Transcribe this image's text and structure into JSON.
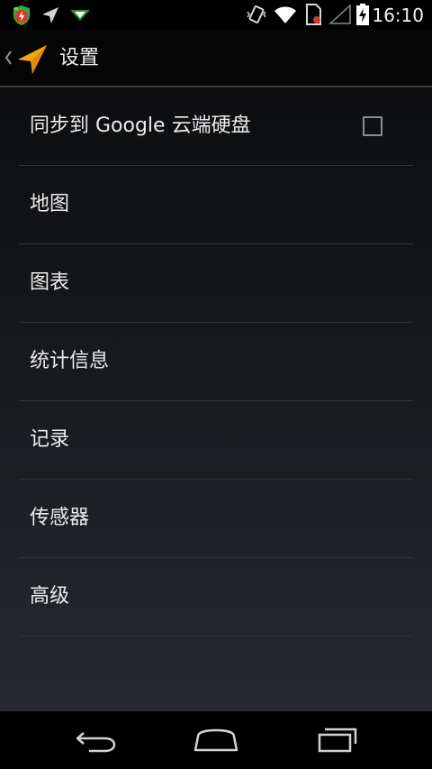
{
  "status_bar": {
    "notification_icons": [
      "green-shield-app-icon",
      "location-arrow-icon",
      "download-arrow-icon"
    ],
    "system_icons": [
      "vibrate-icon",
      "wifi-icon",
      "sim-card-icon",
      "cell-signal-icon",
      "battery-charging-icon"
    ],
    "time": "16:10"
  },
  "action_bar": {
    "title": "设置",
    "logo_icon": "orange-navigation-arrow-icon",
    "up_icon": "chevron-left-icon"
  },
  "preferences": [
    {
      "label": "同步到 Google 云端硬盘",
      "checkbox": true,
      "checked": false
    },
    {
      "label": "地图"
    },
    {
      "label": "图表"
    },
    {
      "label": "统计信息"
    },
    {
      "label": "记录"
    },
    {
      "label": "传感器"
    },
    {
      "label": "高级"
    }
  ],
  "nav_bar": {
    "buttons": [
      "back-icon",
      "home-icon",
      "recent-apps-icon"
    ]
  },
  "colors": {
    "accent": "#f7a21b",
    "logo_green": "#3aa83a",
    "battery_bolt": "#000000"
  }
}
